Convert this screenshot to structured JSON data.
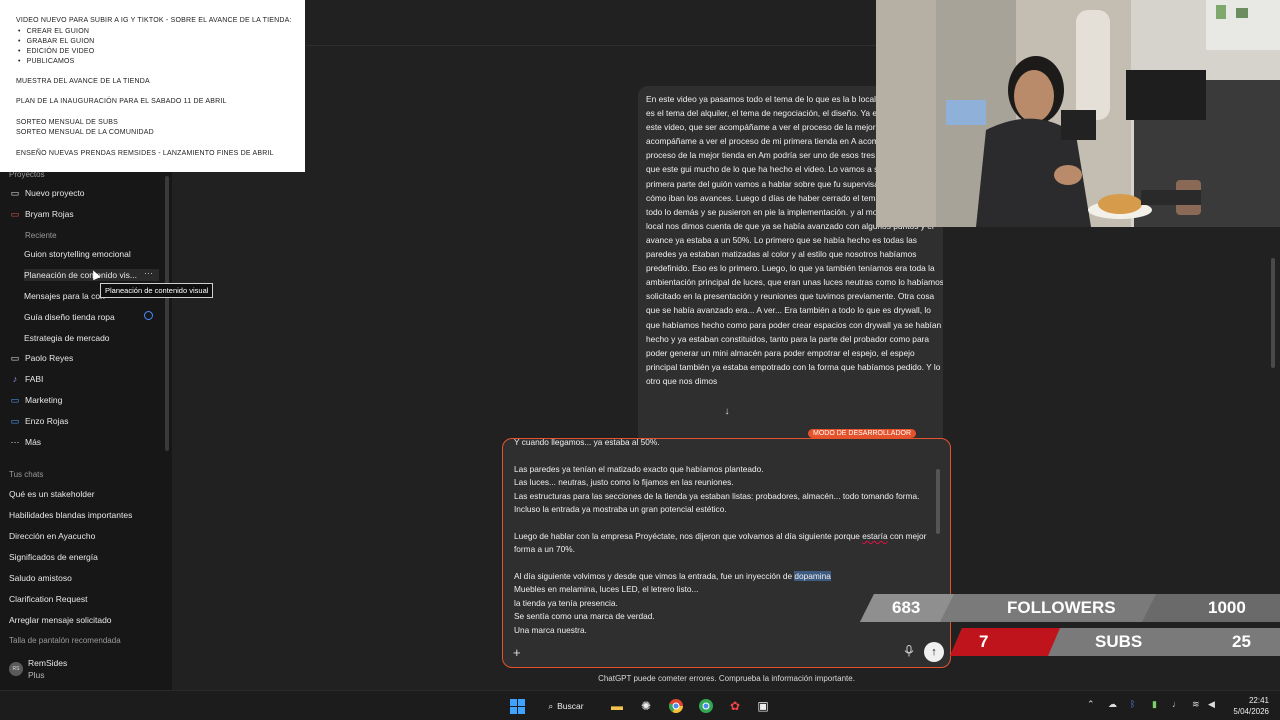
{
  "notes": {
    "title": "VIDEO NUEVO PARA SUBIR A IG Y TIKTOK - SOBRE EL AVANCE DE LA TIENDA:",
    "bullets": [
      "CREAR EL GUION",
      "GRABAR EL GUION",
      "EDICIÓN DE VIDEO",
      "PUBLICAMOS"
    ],
    "line1": "MUESTRA DEL AVANCE DE LA TIENDA",
    "line2": "PLAN DE LA INAUGURACIÓN PARA EL SABADO 11 DE ABRIL",
    "line3": "SORTEO MENSUAL DE SUBS",
    "line4": "SORTEO MENSUAL DE LA COMUNIDAD",
    "line5": "ENSEÑO NUEVAS PRENDAS REMSIDES - LANZAMIENTO FINES DE ABRIL"
  },
  "sidebar": {
    "projects_label": "Proyectos",
    "new_project": "Nuevo proyecto",
    "bryam": "Bryam Rojas",
    "recent": "Reciente",
    "sub_items": [
      "Guion storytelling emocional",
      "Planeación de contenido vis...",
      "Mensajes para la con",
      "Guía diseño tienda ropa",
      "Estrategia de mercado"
    ],
    "folders": [
      "Paolo Reyes",
      "FABI",
      "Marketing",
      "Enzo Rojas"
    ],
    "more": "Más",
    "chats_label": "Tus chats",
    "chats": [
      "Qué es un stakeholder",
      "Habilidades blandas importantes",
      "Dirección en Ayacucho",
      "Significados de energía",
      "Saludo amistoso",
      "Clarification Request",
      "Arreglar mensaje solicitado",
      "Talla de pantalón recomendada"
    ],
    "user_name": "RemSides",
    "user_plan": "Plus",
    "avatar_initials": "RS",
    "tooltip": "Planeación de contenido visual"
  },
  "assistant_text": "En este video ya pasamos todo el tema de lo que es la b local y también lo que es el tema del alquiler, el tema de negociación, el diseño. Ya está todo eso. En este video, que ser acompáñame a ver el proceso de la mejor tiend acompáñame a ver el proceso de mi primera tienda en A acompáñame a ver el proceso de la mejor tienda en Am podría ser uno de esos tres el guión, y creo que este gui mucho de lo que ha hecho el video. Lo vamos a seguir e La primera parte del guión vamos a hablar sobre que fu supervisar, fuimos a ver cómo iban los avances. Luego d días de haber cerrado el tema del contrato y todo lo demás y se pusieron en pie la implementación. y al momento de llegar al local nos dimos cuenta de que ya se había avanzado con algunos puntos y el avance ya estaba a un 50%. Lo primero que se había hecho es todas las paredes ya estaban matizadas al color y al estilo que nosotros habíamos predefinido. Eso es lo primero. Luego, lo que ya también teníamos era toda la ambientación principal de luces, que eran unas luces neutras como lo habíamos solicitado en la presentación y reuniones que tuvimos previamente. Otra cosa que se había avanzado era... A ver... Era también a todo lo que es drywall, lo que habíamos hecho como para poder crear espacios con drywall ya se habían hecho y ya estaban constituidos, tanto para la parte del probador como para poder generar un mini almacén para poder empotrar el espejo, el espejo principal también ya estaba empotrado con la forma que habíamos pedido. Y lo otro que nos dimos",
  "dev_badge": "MODO DE DESARROLLADOR",
  "composer": {
    "l0": "Y cuando llegamos... ya estaba al 50%.",
    "l1": "Las paredes ya tenían el matizado exacto que habíamos planteado.",
    "l2": "Las luces... neutras, justo como lo fijamos en las reuniones.",
    "l3": "Las estructuras para las secciones de la tienda ya estaban listas: probadores, almacén... todo tomando forma. Incluso la entrada ya mostraba un gran potencial estético.",
    "l4a": "Luego de hablar con la empresa Proyéctate, nos dijeron que volvamos al día siguiente porque ",
    "l4b": "estaría",
    "l4c": " con mejor forma a un 70%.",
    "l5a": "Al día siguiente volvimos y desde que vimos la entrada, fue un inyección de ",
    "l5b": "dopamina",
    "l6": "Muebles en melamina, luces LED, el letrero listo...",
    "l7": "la tienda ya tenía presencia.",
    "l8": "Se sentía como una marca de verdad.",
    "l9": "Una marca nuestra."
  },
  "disclaimer": "ChatGPT puede cometer errores. Comprueba la información importante.",
  "overlay": {
    "followers_current": "683",
    "followers_label": "FOLLOWERS",
    "followers_goal": "1000",
    "followers_progress": 0.683,
    "subs_current": "7",
    "subs_label": "SUBS",
    "subs_goal": "25",
    "subs_progress": 0.28,
    "accent_red": "#c0141c",
    "bar_grey": "#7a7a7a"
  },
  "taskbar": {
    "search_label": "Buscar",
    "time": "22:41",
    "date": "5/04/2026"
  }
}
